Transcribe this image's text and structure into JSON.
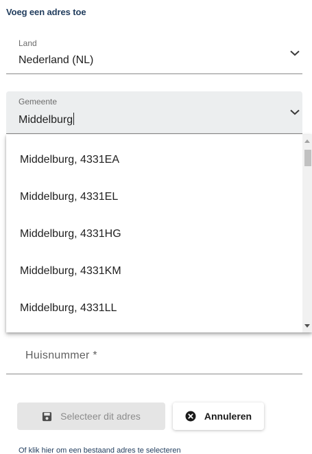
{
  "dialog": {
    "title": "Voeg een adres toe"
  },
  "land": {
    "label": "Land",
    "value": "Nederland (NL)"
  },
  "gemeente": {
    "label": "Gemeente",
    "value": "Middelburg"
  },
  "dropdown": {
    "options": [
      "Middelburg, 4331EA",
      "Middelburg, 4331EL",
      "Middelburg, 4331HG",
      "Middelburg, 4331KM",
      "Middelburg, 4331LL"
    ]
  },
  "huisnummer": {
    "placeholder": "Huisnummer  *"
  },
  "buttons": {
    "select_label": "Selecteer dit adres",
    "cancel_label": "Annuleren"
  },
  "footer": {
    "link_text": "Of klik hier om een bestaand adres te selecteren"
  },
  "icons": {
    "chevron": "chevron-down-icon",
    "save": "save-icon",
    "cancel": "close-circle-icon"
  }
}
